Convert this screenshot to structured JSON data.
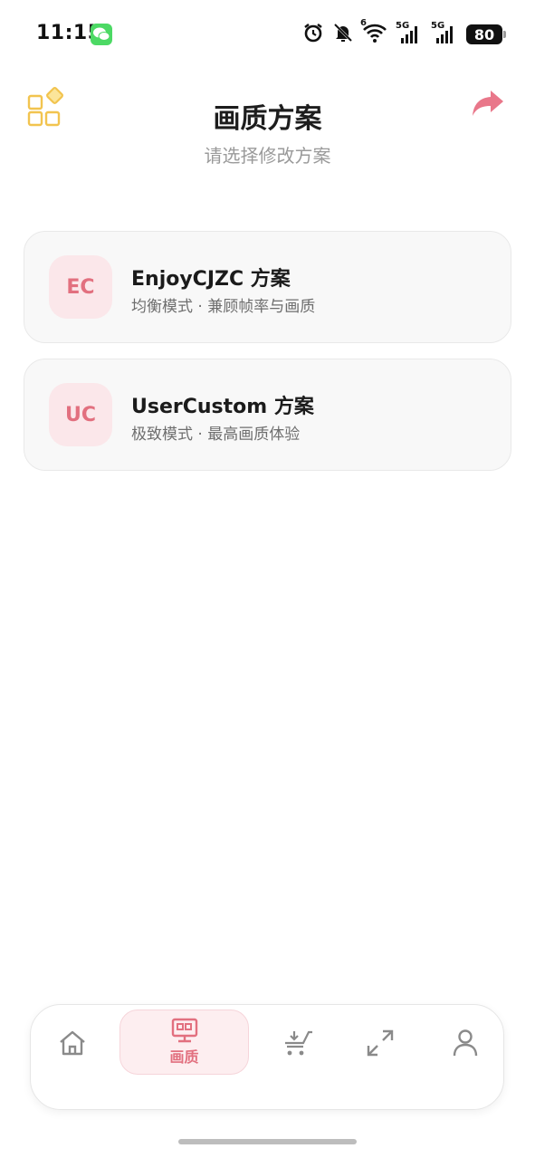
{
  "status_bar": {
    "time": "11:15",
    "battery": "80",
    "network_1": "5G",
    "network_2": "5G",
    "wifi_badge": "6"
  },
  "header": {
    "title": "画质方案",
    "subtitle": "请选择修改方案"
  },
  "schemes": [
    {
      "badge": "EC",
      "title": "EnjoyCJZC 方案",
      "description": "均衡模式 · 兼顾帧率与画质"
    },
    {
      "badge": "UC",
      "title": "UserCustom 方案",
      "description": "极致模式 · 最高画质体验"
    }
  ],
  "bottom_nav": {
    "active_label": "画质"
  },
  "colors": {
    "accent": "#e2707f",
    "accent_bg": "#fdeef0",
    "apps_icon": "#f2c44f",
    "subtitle": "#9a9a9a"
  }
}
